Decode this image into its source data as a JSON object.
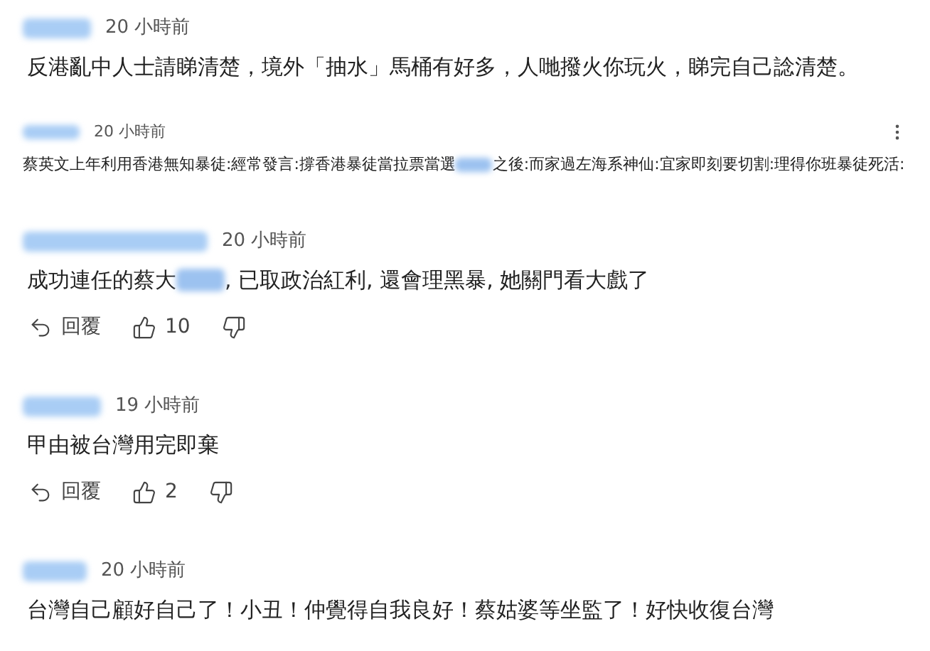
{
  "comments": [
    {
      "kind": "standard",
      "time": "20 小時前",
      "text": [
        "反港亂中人士請睇清楚，境外「抽水」馬桶有好多，人哋撥火你玩火，睇完自己諗清楚。"
      ]
    },
    {
      "kind": "compact",
      "time": "20 小時前",
      "text": [
        "蔡英文上年利用香港無知暴徒:經常發言:撐香港暴徒當拉票當選",
        "之後:而家過左海系神仙:宜家即刻要切割:理得你班暴徒死活:"
      ]
    },
    {
      "kind": "standard",
      "time": "20 小時前",
      "text": [
        "成功連任的蔡大",
        ", 已取政治紅利, 還會理黑暴, 她關門看大戲了"
      ],
      "reply": "回覆",
      "likes": "10"
    },
    {
      "kind": "standard",
      "time": "19 小時前",
      "text": [
        "甲由被台灣用完即棄"
      ],
      "reply": "回覆",
      "likes": "2"
    },
    {
      "kind": "standard",
      "time": "20 小時前",
      "text": [
        "台灣自己顧好自己了！小丑！仲覺得自我良好！蔡姑婆等坐監了！好快收復台灣"
      ]
    }
  ]
}
